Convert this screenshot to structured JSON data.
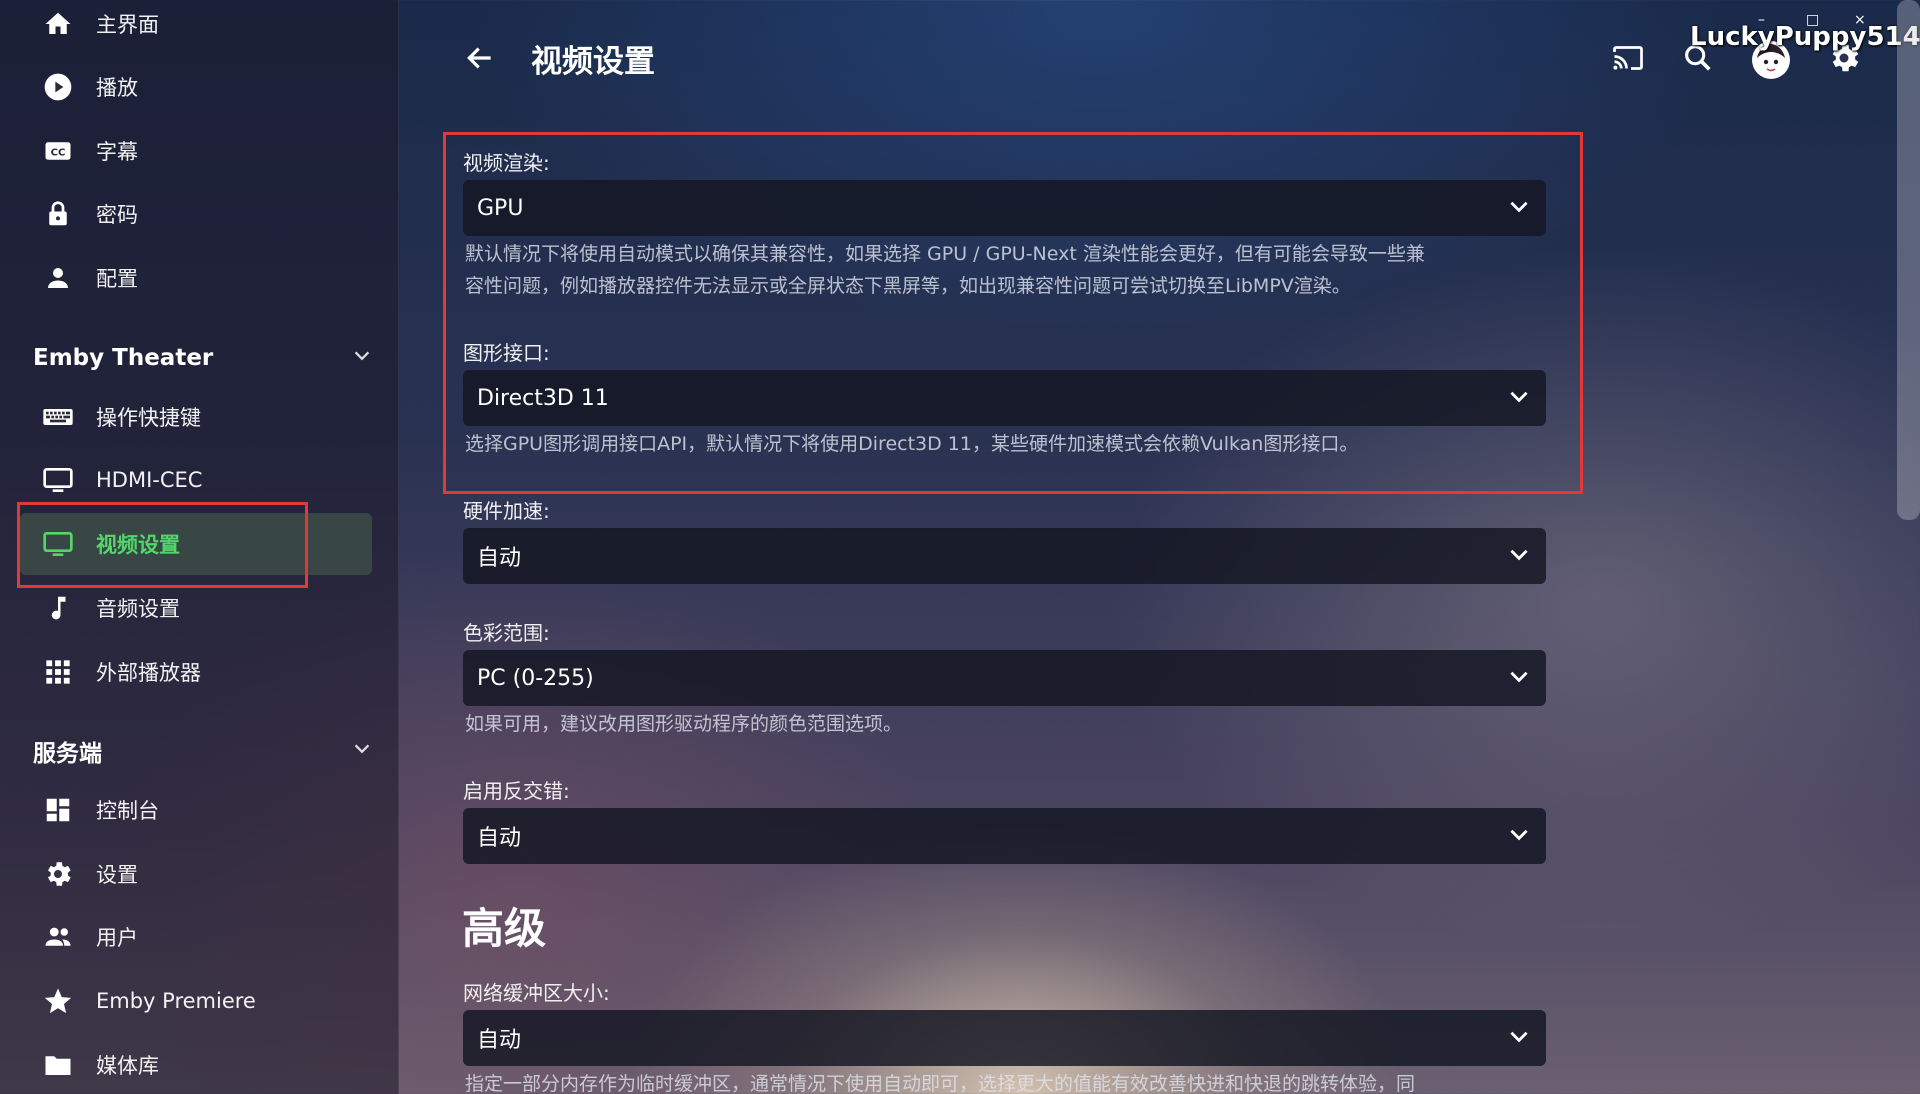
{
  "sidebar": {
    "top_items": [
      {
        "label": "主界面",
        "icon": "home-icon"
      },
      {
        "label": "播放",
        "icon": "play-icon"
      },
      {
        "label": "字幕",
        "icon": "closed-captions-icon"
      },
      {
        "label": "密码",
        "icon": "lock-icon"
      },
      {
        "label": "配置",
        "icon": "person-icon"
      }
    ],
    "theater_section": {
      "title": "Emby Theater",
      "items": [
        {
          "label": "操作快捷键",
          "icon": "keyboard-icon"
        },
        {
          "label": "HDMI-CEC",
          "icon": "monitor-icon"
        },
        {
          "label": "视频设置",
          "icon": "monitor-icon",
          "active": true
        },
        {
          "label": "音频设置",
          "icon": "music-note-icon"
        },
        {
          "label": "外部播放器",
          "icon": "grid-icon"
        }
      ]
    },
    "server_section": {
      "title": "服务端",
      "items": [
        {
          "label": "控制台",
          "icon": "dashboard-icon"
        },
        {
          "label": "设置",
          "icon": "gear-icon"
        },
        {
          "label": "用户",
          "icon": "users-icon"
        },
        {
          "label": "Emby Premiere",
          "icon": "star-icon"
        },
        {
          "label": "媒体库",
          "icon": "folder-icon"
        }
      ]
    }
  },
  "header": {
    "title": "视频设置",
    "username": "LuckyPuppy514",
    "icons": [
      "cast-icon",
      "search-icon",
      "avatar",
      "gear-icon"
    ]
  },
  "window_controls": {
    "minimize": "–",
    "maximize": "□",
    "close": "×"
  },
  "fields": {
    "render": {
      "label": "视频渲染:",
      "value": "GPU",
      "help_line1": "默认情况下将使用自动模式以确保其兼容性，如果选择 GPU / GPU-Next 渲染性能会更好，但有可能会导致一些兼",
      "help_line2": "容性问题，例如播放器控件无法显示或全屏状态下黑屏等，如出现兼容性问题可尝试切换至LibMPV渲染。"
    },
    "graphics_api": {
      "label": "图形接口:",
      "value": "Direct3D 11",
      "help": "选择GPU图形调用接口API，默认情况下将使用Direct3D 11，某些硬件加速模式会依赖Vulkan图形接口。"
    },
    "hw_accel": {
      "label": "硬件加速:",
      "value": "自动"
    },
    "color_range": {
      "label": "色彩范围:",
      "value": "PC (0-255)",
      "help": "如果可用，建议改用图形驱动程序的颜色范围选项。"
    },
    "deinterlace": {
      "label": "启用反交错:",
      "value": "自动"
    },
    "advanced_title": "高级",
    "network_buffer": {
      "label": "网络缓冲区大小:",
      "value": "自动",
      "help": "指定一部分内存作为临时缓冲区，通常情况下使用自动即可，选择更大的值能有效改善快进和快退的跳转体验，同"
    }
  },
  "colors": {
    "accent_green": "#52d66a",
    "highlight_red": "#e23838"
  }
}
